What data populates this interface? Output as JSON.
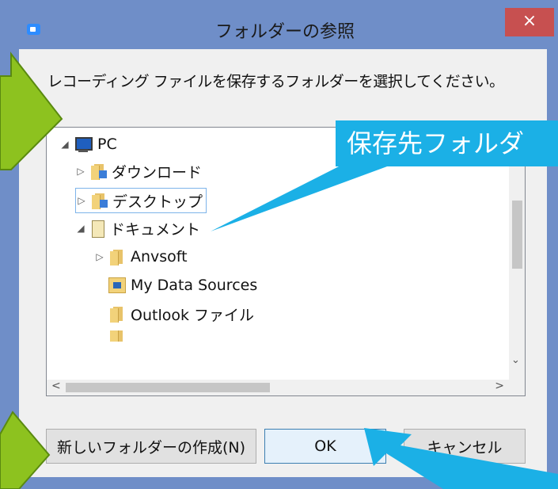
{
  "window": {
    "title": "フォルダーの参照",
    "close_label": "×"
  },
  "instruction": "レコーディング ファイルを保存するフォルダーを選択してください。",
  "tree": {
    "items": [
      {
        "label": "PC"
      },
      {
        "label": "ダウンロード"
      },
      {
        "label": "デスクトップ"
      },
      {
        "label": "ドキュメント"
      },
      {
        "label": "Anvsoft"
      },
      {
        "label": "My Data Sources"
      },
      {
        "label": "Outlook ファイル"
      }
    ]
  },
  "buttons": {
    "new_folder": "新しいフォルダーの作成(N)",
    "ok": "OK",
    "cancel": "キャンセル"
  },
  "callout": {
    "text": "保存先フォルダ"
  },
  "colors": {
    "callout": "#1bb0e6",
    "green_arrow": "#8dc21f",
    "close": "#c75050"
  }
}
